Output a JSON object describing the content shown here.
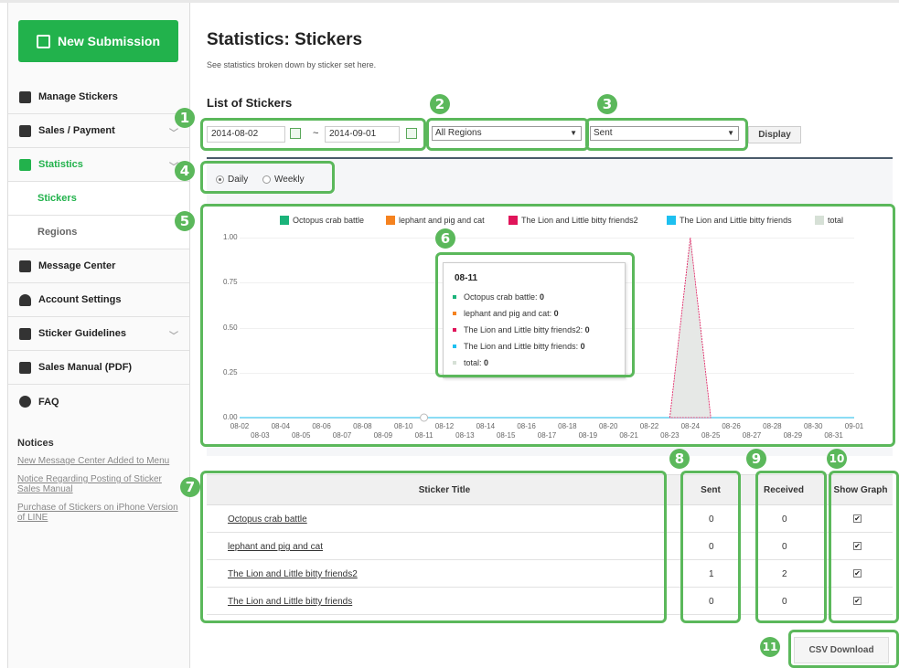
{
  "sidebar": {
    "new_submission": "New Submission",
    "items": [
      {
        "label": "Manage Stickers",
        "icon": "gear-icon"
      },
      {
        "label": "Sales / Payment",
        "icon": "database-icon"
      },
      {
        "label": "Statistics",
        "icon": "bar-chart-icon"
      },
      {
        "label": "Stickers"
      },
      {
        "label": "Regions"
      },
      {
        "label": "Message Center",
        "icon": "envelope-icon"
      },
      {
        "label": "Account Settings",
        "icon": "person-icon"
      },
      {
        "label": "Sticker Guidelines",
        "icon": "document-icon"
      },
      {
        "label": "Sales Manual (PDF)",
        "icon": "file-icon"
      },
      {
        "label": "FAQ",
        "icon": "question-icon"
      }
    ],
    "notices_title": "Notices",
    "notices": [
      "New Message Center Added to Menu",
      "Notice Regarding Posting of Sticker Sales Manual",
      "Purchase of Stickers on iPhone Version of LINE"
    ]
  },
  "header": {
    "title": "Statistics: Stickers",
    "subtitle": "See statistics broken down by sticker set here.",
    "list_title": "List of Stickers"
  },
  "filters": {
    "date_from": "2014-08-02",
    "tilde": "~",
    "date_to": "2014-09-01",
    "region": "All Regions",
    "metric": "Sent",
    "display_button": "Display",
    "daily": "Daily",
    "weekly": "Weekly",
    "selected_period": "Daily"
  },
  "annotations": [
    "1",
    "2",
    "3",
    "4",
    "5",
    "6",
    "7",
    "8",
    "9",
    "10",
    "11"
  ],
  "chart_data": {
    "type": "area",
    "legend": [
      {
        "name": "Octopus crab battle",
        "color": "#1bb37a"
      },
      {
        "name": "lephant and pig and cat",
        "color": "#f5821f"
      },
      {
        "name": "The Lion and Little bitty friends2",
        "color": "#e0145a"
      },
      {
        "name": "The Lion and Little bitty friends",
        "color": "#1ec0f0"
      },
      {
        "name": "total",
        "color": "#d6e0d6"
      }
    ],
    "yticks": [
      "1.00",
      "0.75",
      "0.50",
      "0.25",
      "0.00"
    ],
    "ylim": [
      0,
      1
    ],
    "x_top": [
      "08-02",
      "08-04",
      "08-06",
      "08-08",
      "08-10",
      "08-12",
      "08-14",
      "08-16",
      "08-18",
      "08-20",
      "08-22",
      "08-24",
      "08-26",
      "08-28",
      "08-30",
      "09-01"
    ],
    "x_bottom": [
      "08-03",
      "08-05",
      "08-07",
      "08-09",
      "08-11",
      "08-13",
      "08-15",
      "08-17",
      "08-19",
      "08-21",
      "08-23",
      "08-25",
      "08-27",
      "08-29",
      "08-31"
    ],
    "series": [
      {
        "name": "The Lion and Little bitty friends2",
        "peak_date": "08-24",
        "peak_value": 1
      },
      {
        "name": "total",
        "peak_date": "08-24",
        "peak_value": 1
      }
    ],
    "tooltip": {
      "date": "08-11",
      "rows": [
        {
          "label": "Octopus crab battle:",
          "value": "0",
          "color": "#1bb37a"
        },
        {
          "label": "lephant and pig and cat:",
          "value": "0",
          "color": "#f5821f"
        },
        {
          "label": "The Lion and Little bitty friends2:",
          "value": "0",
          "color": "#e0145a"
        },
        {
          "label": "The Lion and Little bitty friends:",
          "value": "0",
          "color": "#1ec0f0"
        },
        {
          "label": "total:",
          "value": "0",
          "color": "#d6e0d6"
        }
      ]
    }
  },
  "table": {
    "headers": [
      "Sticker Title",
      "Sent",
      "Received",
      "Show Graph"
    ],
    "rows": [
      {
        "title": "Octopus crab battle",
        "sent": "0",
        "received": "0",
        "show": "✔"
      },
      {
        "title": "lephant and pig and cat",
        "sent": "0",
        "received": "0",
        "show": "✔"
      },
      {
        "title": "The Lion and Little bitty friends2",
        "sent": "1",
        "received": "2",
        "show": "✔"
      },
      {
        "title": "The Lion and Little bitty friends",
        "sent": "0",
        "received": "0",
        "show": "✔"
      }
    ],
    "csv_button": "CSV Download"
  }
}
